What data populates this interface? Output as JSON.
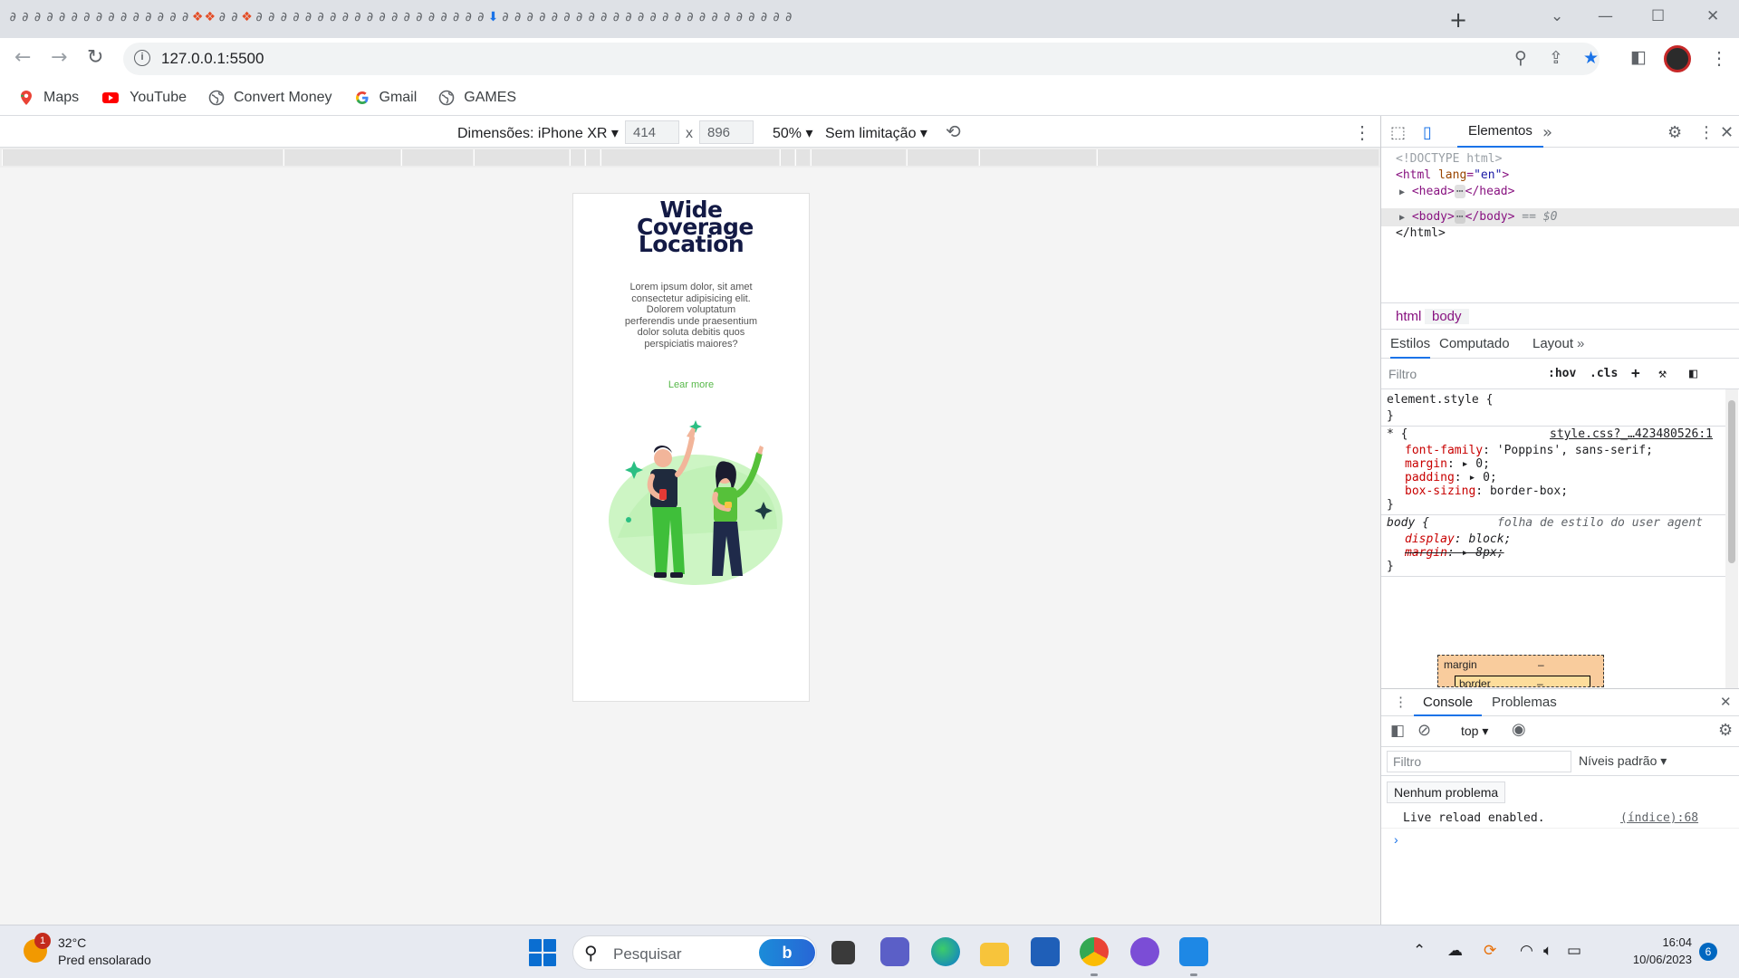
{
  "browser": {
    "url": "127.0.0.1:5500",
    "tab_count_icons": 64,
    "window_controls": {
      "minimize": "—",
      "maximize": "☐",
      "close": "✕",
      "dropdown": "⌄"
    },
    "new_tab": "+"
  },
  "bookmarks": [
    {
      "label": "Maps",
      "icon": "maps-pin-icon"
    },
    {
      "label": "YouTube",
      "icon": "youtube-icon"
    },
    {
      "label": "Convert Money",
      "icon": "globe-icon"
    },
    {
      "label": "Gmail",
      "icon": "google-icon"
    },
    {
      "label": "GAMES",
      "icon": "globe-icon"
    }
  ],
  "device_toolbar": {
    "dimensions_label": "Dimensões: iPhone XR ▾",
    "width": "414",
    "times": "x",
    "height": "896",
    "zoom": "50% ▾",
    "throttle": "Sem limitação ▾"
  },
  "page": {
    "title": "Wide Coverage Location",
    "body": "Lorem ipsum dolor, sit amet consectetur adipisicing elit. Dolorem voluptatum perferendis unde praesentium dolor soluta debitis quos perspiciatis maiores?",
    "link": "Lear more"
  },
  "devtools": {
    "main_tab": "Elementos",
    "dom": {
      "doctype": "<!DOCTYPE html>",
      "html_open_tag": "<html",
      "html_attr_name": "lang",
      "html_attr_value": "\"en\"",
      "head": "<head>",
      "head_close": "</head>",
      "body": "<body>",
      "body_close": "</body>",
      "body_suffix": "== $0",
      "html_close": "</html>"
    },
    "breadcrumbs": [
      "html",
      "body"
    ],
    "styles_tabs": [
      "Estilos",
      "Computado",
      "Layout"
    ],
    "filter_placeholder": "Filtro",
    "hov": ":hov",
    "cls": ".cls",
    "rules": {
      "element_style": "element.style {",
      "close": "}",
      "star_selector": "* {",
      "star_source": "style.css?_…423480526:1",
      "props": [
        {
          "name": "font-family",
          "value": "'Poppins', sans-serif;"
        },
        {
          "name": "margin",
          "value": "▸ 0;"
        },
        {
          "name": "padding",
          "value": "▸ 0;"
        },
        {
          "name": "box-sizing",
          "value": "border-box;"
        }
      ],
      "body_selector": "body {",
      "body_source": "folha de estilo do user agent",
      "body_props": [
        {
          "name": "display",
          "value": "block;"
        },
        {
          "name": "margin",
          "value": "▸ 8px;"
        }
      ]
    },
    "box_model": {
      "margin": "margin",
      "border": "border",
      "dash": "–"
    },
    "console": {
      "tabs": [
        "Console",
        "Problemas"
      ],
      "context": "top ▾",
      "filter_placeholder": "Filtro",
      "levels": "Níveis padrão ▾",
      "issues": "Nenhum problema",
      "log_text": "Live reload enabled.",
      "log_source": "(índice):68",
      "prompt": "›"
    }
  },
  "taskbar": {
    "temperature": "32°C",
    "weather": "Pred ensolarado",
    "weather_badge": "1",
    "search_label": "Pesquisar",
    "bing": "b",
    "time": "16:04",
    "date": "10/06/2023",
    "notifications": "6"
  },
  "colors": {
    "title": "#131a45",
    "accent_link": "#56b848",
    "devtools_tab_underline": "#1a73e8"
  }
}
